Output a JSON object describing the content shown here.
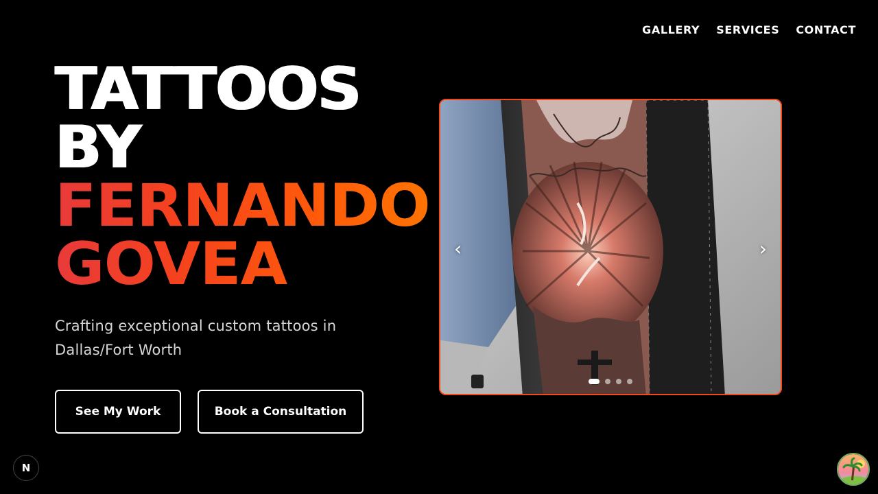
{
  "nav": {
    "items": [
      {
        "label": "GALLERY"
      },
      {
        "label": "SERVICES"
      },
      {
        "label": "CONTACT"
      }
    ]
  },
  "hero": {
    "title_line1": "TATTOOS",
    "title_line2": "BY",
    "title_line3": "FERNANDO",
    "title_line4": "GOVEA",
    "tagline": "Crafting exceptional custom tattoos in Dallas/Fort Worth",
    "primary_button": "See My Work",
    "secondary_button": "Book a Consultation"
  },
  "carousel": {
    "prev_icon": "chevron-left-icon",
    "next_icon": "chevron-right-icon",
    "prev_glyph": "‹",
    "next_glyph": "›",
    "slide_count": 4,
    "active_slide": 1,
    "border_color": "#f24a1d"
  },
  "badge": {
    "letter": "N"
  },
  "colors": {
    "background": "#000000",
    "accent_start": "#e83a3a",
    "accent_end": "#ff7a00"
  }
}
